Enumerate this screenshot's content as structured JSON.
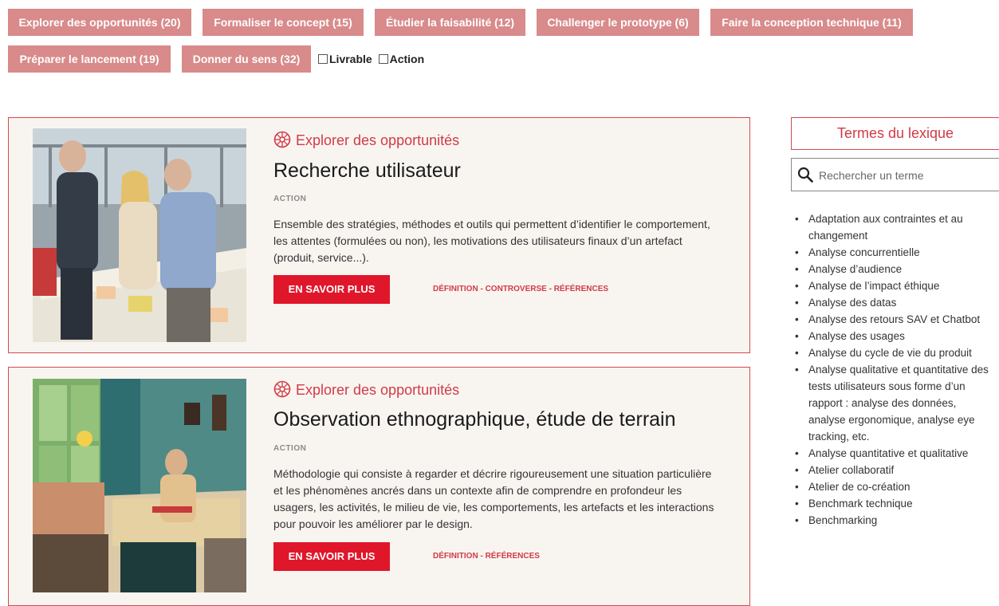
{
  "filters": [
    {
      "label": "Explorer des opportunités (20)"
    },
    {
      "label": "Formaliser le concept (15)"
    },
    {
      "label": "Étudier la faisabilité (12)"
    },
    {
      "label": "Challenger le prototype (6)"
    },
    {
      "label": "Faire la conception technique (11)"
    },
    {
      "label": "Préparer le lancement (19)"
    },
    {
      "label": "Donner du sens (32)"
    }
  ],
  "checkboxes": {
    "livrable": "Livrable",
    "action": "Action"
  },
  "cards": [
    {
      "category": "Explorer des opportunités",
      "title": "Recherche utilisateur",
      "type": "ACTION",
      "description": "Ensemble des stratégies, méthodes et outils qui permettent d’identifier le comportement, les attentes (formulées ou non), les motivations des utilisateurs finaux d’un artefact (produit, service...).",
      "button": "EN SAVOIR PLUS",
      "links": [
        "DÉFINITION",
        "CONTROVERSE",
        "RÉFÉRENCES"
      ],
      "separator": " - "
    },
    {
      "category": "Explorer des opportunités",
      "title": "Observation ethnographique, étude de terrain",
      "type": "ACTION",
      "description": "Méthodologie qui consiste à regarder et décrire rigoureusement une situation particulière et les phénomènes ancrés dans un contexte afin de comprendre en profondeur les usagers, les activités, le milieu de vie, les comportements, les artefacts et les interactions pour pouvoir les améliorer par le design.",
      "button": "EN SAVOIR PLUS",
      "links": [
        "DÉFINITION",
        "RÉFÉRENCES"
      ],
      "separator": " - "
    }
  ],
  "sidebar": {
    "title": "Termes du lexique",
    "search_placeholder": "Rechercher un terme",
    "terms": [
      "Adaptation aux contraintes et au changement",
      "Analyse concurrentielle",
      "Analyse d’audience",
      "Analyse de l’impact éthique",
      "Analyse des datas",
      "Analyse des retours SAV et Chatbot",
      "Analyse des usages",
      "Analyse du cycle de vie du produit",
      "Analyse qualitative et quantitative des tests utilisateurs sous forme d’un rapport : analyse des données, analyse ergonomique, analyse eye tracking, etc.",
      "Analyse quantitative et qualitative",
      "Atelier collaboratif",
      "Atelier de co-création",
      "Benchmark technique",
      "Benchmarking"
    ]
  },
  "colors": {
    "accent": "#e0162b",
    "pill": "#d98a8a",
    "border": "#d24b4b",
    "card_bg": "#f8f5f1"
  }
}
